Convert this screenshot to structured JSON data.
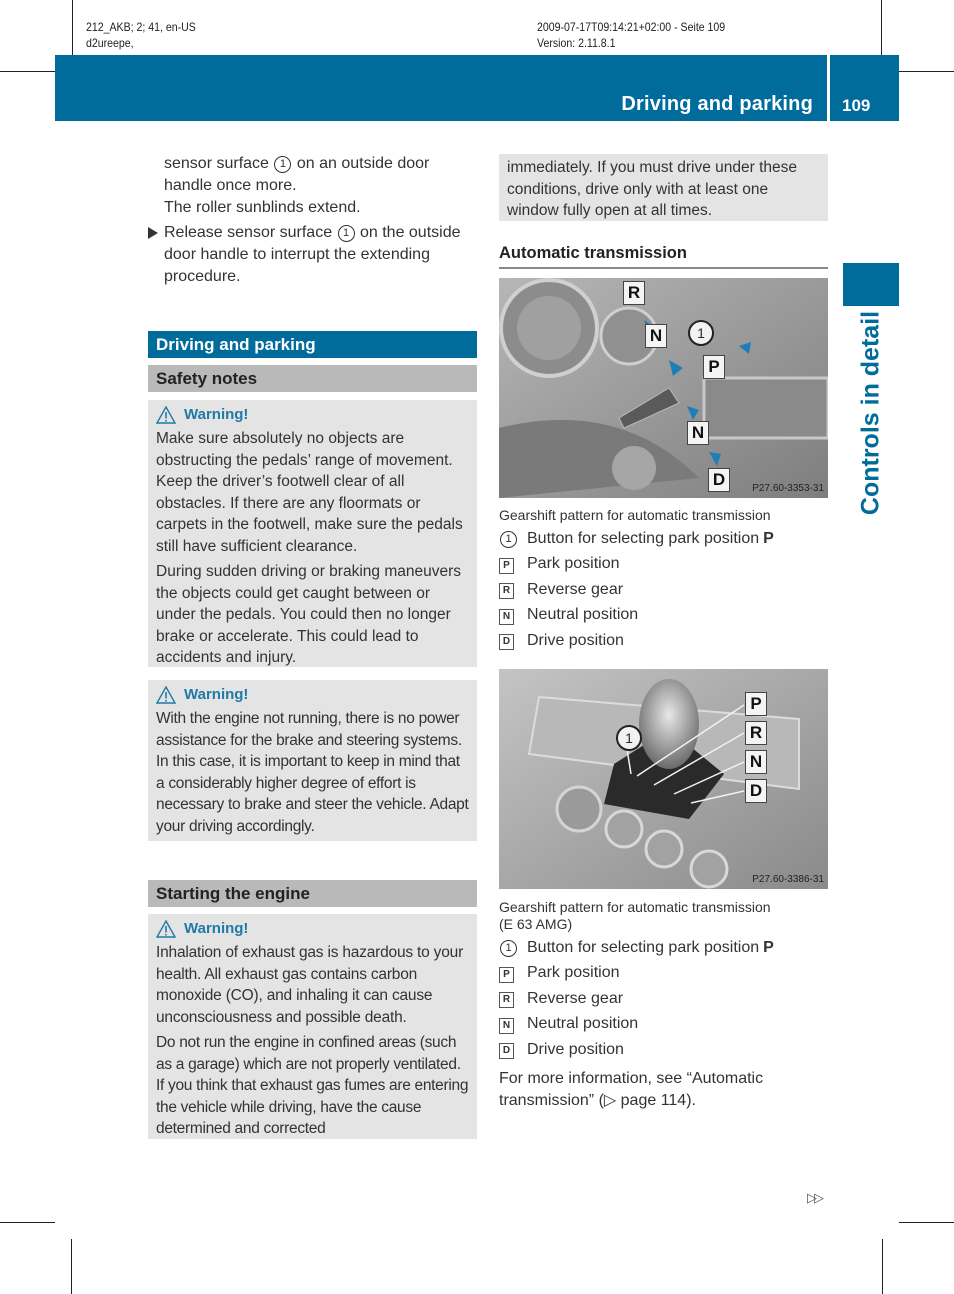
{
  "meta": {
    "left_line1": "212_AKB; 2; 41, en-US",
    "left_line2": "d2ureepe,",
    "right_line1": "2009-07-17T09:14:21+02:00 - Seite 109",
    "right_line2": "Version: 2.11.8.1"
  },
  "header": {
    "title": "Driving and parking",
    "page_number": "109",
    "brand_color": "#006c9c"
  },
  "side_tab": {
    "label": "Controls in detail"
  },
  "left_column": {
    "intro": {
      "line1_before": "sensor surface ",
      "line1_marker": "1",
      "line1_after": " on an outside door handle once more.",
      "result": "The roller sunblinds extend."
    },
    "step": {
      "before": "Release sensor surface ",
      "marker": "1",
      "after": " on the outside door handle to interrupt the extending procedure."
    },
    "section_heading": "Driving and parking",
    "safety_heading": "Safety notes",
    "warning1": {
      "title": "Warning!",
      "para1": "Make sure absolutely no objects are obstructing the pedals’ range of movement. Keep the driver’s footwell clear of all obstacles. If there are any floormats or carpets in the footwell, make sure the pedals still have sufficient clearance.",
      "para2": "During sudden driving or braking maneuvers the objects could get caught between or under the pedals. You could then no longer brake or accelerate. This could lead to accidents and injury."
    },
    "warning2": {
      "title": "Warning!",
      "para1": "With the engine not running, there is no power assistance for the brake and steering systems. In this case, it is important to keep in mind that a considerably higher degree of effort is necessary to brake and steer the vehicle. Adapt your driving accordingly."
    },
    "starting_heading": "Starting the engine",
    "warning3": {
      "title": "Warning!",
      "para1": "Inhalation of exhaust gas is hazardous to your health. All exhaust gas contains carbon monoxide (CO), and inhaling it can cause unconsciousness and possible death.",
      "para2": "Do not run the engine in confined areas (such as a garage) which are not properly ventilated. If you think that exhaust gas fumes are entering the vehicle while driving, have the cause determined and corrected"
    }
  },
  "right_column": {
    "warning_continued": "immediately. If you must drive under these conditions, drive only with at least one window fully open at all times.",
    "subheading": "Automatic transmission",
    "figure1": {
      "code": "P27.60-3353-31",
      "labels": [
        "R",
        "N",
        "P",
        "N",
        "D"
      ],
      "callout": "1",
      "caption": "Gearshift pattern for automatic transmission"
    },
    "legend1": [
      {
        "key": "1",
        "type": "circle",
        "text": "Button for selecting park position ",
        "bold": "P"
      },
      {
        "key": "P",
        "type": "square",
        "text": "Park position",
        "bold": ""
      },
      {
        "key": "R",
        "type": "square",
        "text": "Reverse gear",
        "bold": ""
      },
      {
        "key": "N",
        "type": "square",
        "text": "Neutral position",
        "bold": ""
      },
      {
        "key": "D",
        "type": "square",
        "text": "Drive position",
        "bold": ""
      }
    ],
    "figure2": {
      "code": "P27.60-3386-31",
      "labels": [
        "P",
        "R",
        "N",
        "D"
      ],
      "callout": "1",
      "caption_line1": "Gearshift pattern for automatic transmission",
      "caption_line2": "(E 63 AMG)"
    },
    "legend2": [
      {
        "key": "1",
        "type": "circle",
        "text": "Button for selecting park position ",
        "bold": "P"
      },
      {
        "key": "P",
        "type": "square",
        "text": "Park position",
        "bold": ""
      },
      {
        "key": "R",
        "type": "square",
        "text": "Reverse gear",
        "bold": ""
      },
      {
        "key": "N",
        "type": "square",
        "text": "Neutral position",
        "bold": ""
      },
      {
        "key": "D",
        "type": "square",
        "text": "Drive position",
        "bold": ""
      }
    ],
    "more_info": "For more information, see “Automatic transmission” (▷ page 114)."
  },
  "footer": {
    "continue_icon": "double-triangle-right-icon",
    "continue_glyph": "▷▷"
  }
}
